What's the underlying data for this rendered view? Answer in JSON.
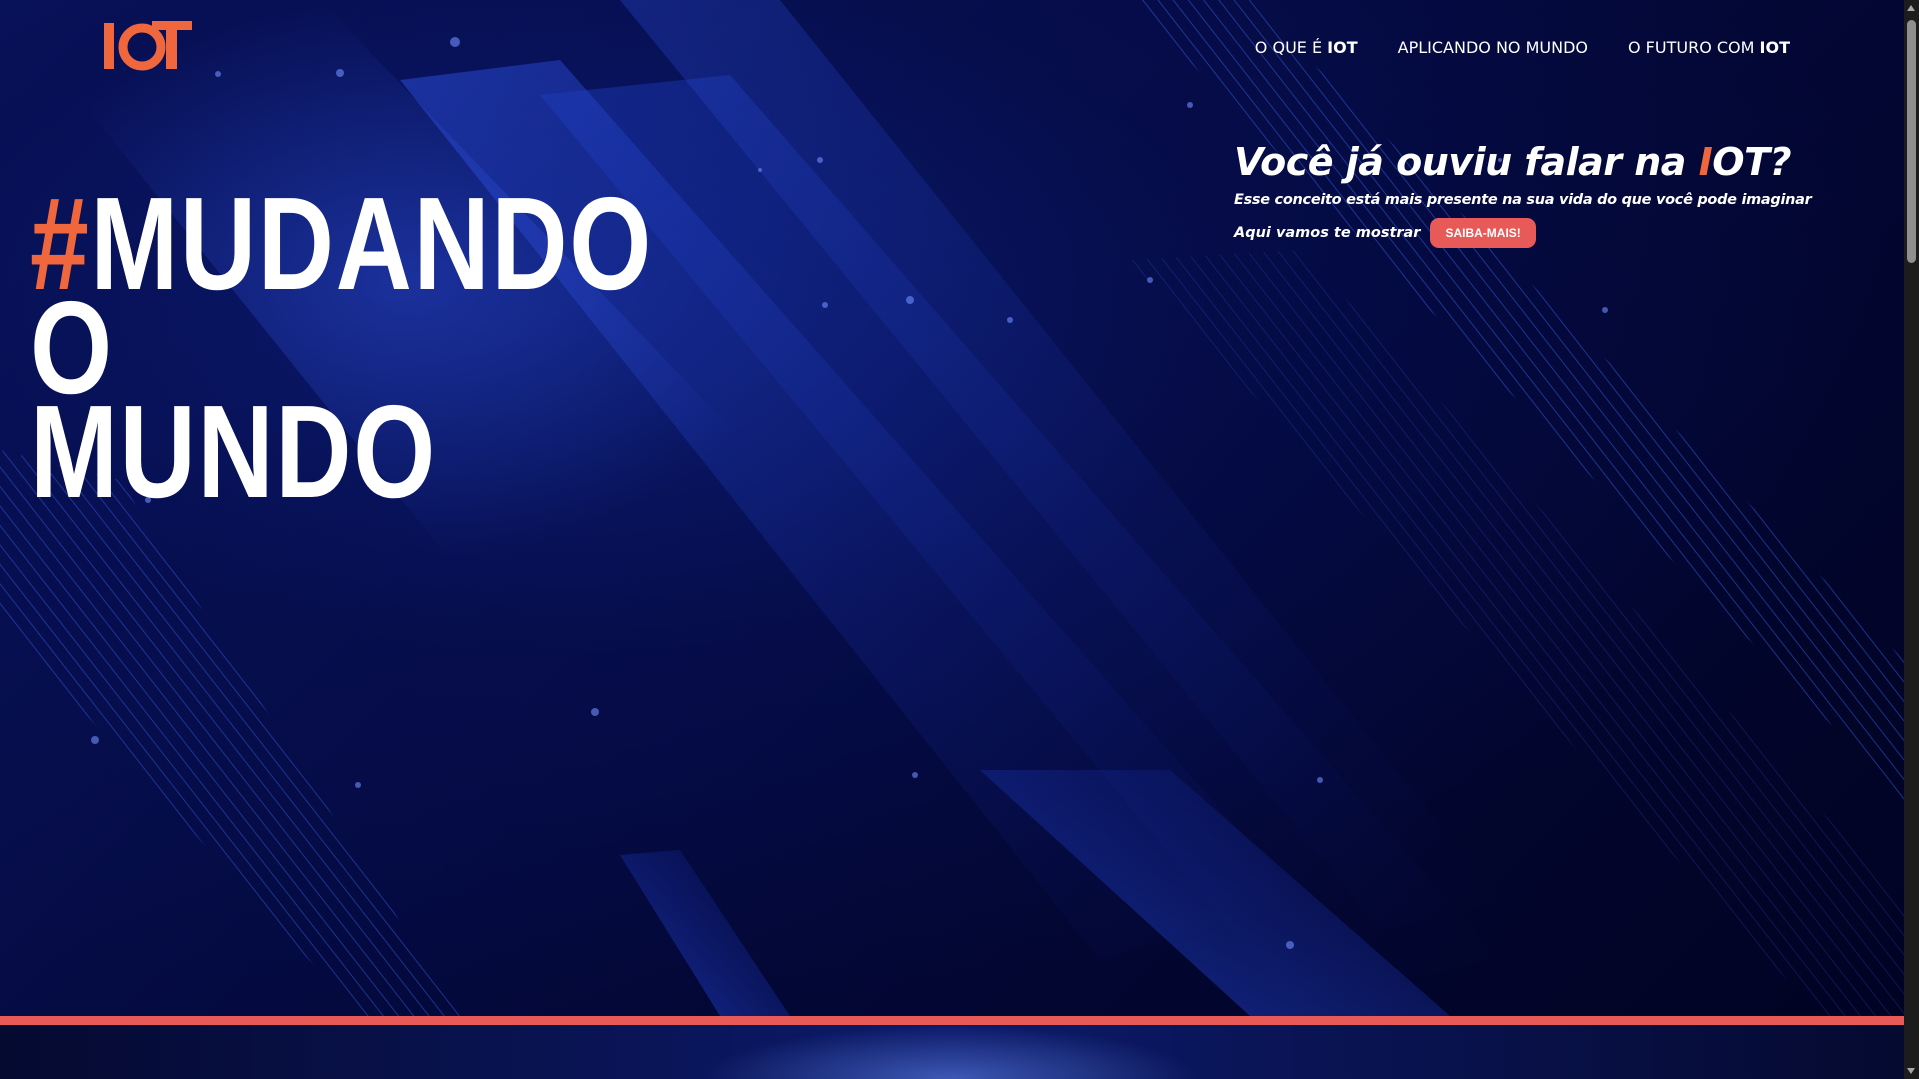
{
  "brand": {
    "logo_text": "IOT",
    "accent_color": "#e85a57",
    "logo_color": "#f0673e",
    "background_color": "#02051f"
  },
  "nav": {
    "items": [
      {
        "prefix": "O QUE É ",
        "strong": "IOT"
      },
      {
        "prefix": "APLICANDO NO MUNDO",
        "strong": ""
      },
      {
        "prefix": "O FUTURO COM ",
        "strong": "IOT"
      }
    ]
  },
  "hero": {
    "hashtag": "#",
    "line1": "MUDANDO",
    "line2": "O",
    "line3": "MUNDO"
  },
  "intro": {
    "title_before": "Você já ouviu falar na ",
    "title_highlight": "I",
    "title_after": "OT?",
    "subtitle": "Esse conceito está mais presente na sua vida do que você pode imaginar",
    "cta_lead": "Aqui vamos te mostrar",
    "cta_label": "SAIBA-MAIS!"
  }
}
